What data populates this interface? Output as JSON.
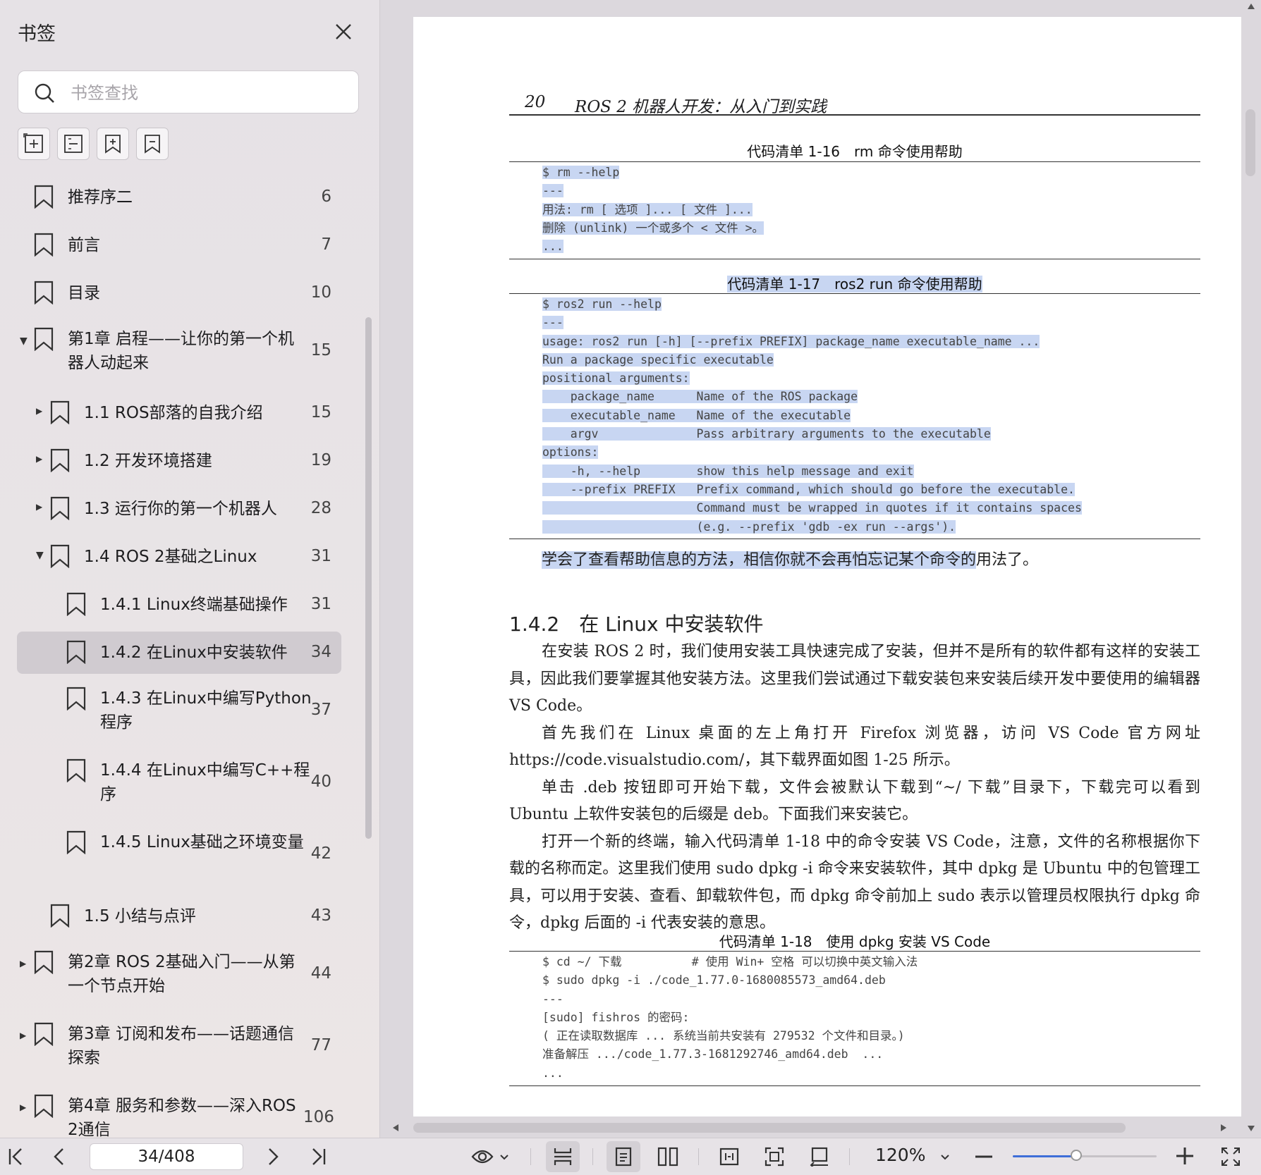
{
  "sidebar": {
    "title": "书签",
    "search_placeholder": "书签查找",
    "bookmarks": [
      {
        "label": "推荐序二",
        "page": "6",
        "level": 0,
        "expand": "none",
        "lines": 1
      },
      {
        "label": "前言",
        "page": "7",
        "level": 0,
        "expand": "none",
        "lines": 1
      },
      {
        "label": "目录",
        "page": "10",
        "level": 0,
        "expand": "none",
        "lines": 1
      },
      {
        "label": "第1章 启程——让你的第一个机器人动起来",
        "page": "15",
        "level": 0,
        "expand": "open",
        "lines": 2
      },
      {
        "label": "1.1 ROS部落的自我介绍",
        "page": "15",
        "level": 1,
        "expand": "closed",
        "lines": 1
      },
      {
        "label": "1.2 开发环境搭建",
        "page": "19",
        "level": 1,
        "expand": "closed",
        "lines": 1
      },
      {
        "label": "1.3 运行你的第一个机器人",
        "page": "28",
        "level": 1,
        "expand": "closed",
        "lines": 1
      },
      {
        "label": "1.4 ROS 2基础之Linux",
        "page": "31",
        "level": 1,
        "expand": "open",
        "lines": 1
      },
      {
        "label": "1.4.1 Linux终端基础操作",
        "page": "31",
        "level": 2,
        "expand": "none",
        "lines": 1
      },
      {
        "label": "1.4.2 在Linux中安装软件",
        "page": "34",
        "level": 2,
        "expand": "none",
        "lines": 1,
        "selected": true
      },
      {
        "label": "1.4.3 在Linux中编写Python程序",
        "page": "37",
        "level": 2,
        "expand": "none",
        "lines": 2
      },
      {
        "label": "1.4.4 在Linux中编写C++程序",
        "page": "40",
        "level": 2,
        "expand": "none",
        "lines": 2
      },
      {
        "label": "1.4.5 Linux基础之环境变量",
        "page": "42",
        "level": 2,
        "expand": "none",
        "lines": 2
      },
      {
        "label": "1.5 小结与点评",
        "page": "43",
        "level": 1,
        "expand": "none",
        "lines": 1
      },
      {
        "label": "第2章 ROS 2基础入门——从第一个节点开始",
        "page": "44",
        "level": 0,
        "expand": "closed",
        "lines": 2
      },
      {
        "label": "第3章 订阅和发布——话题通信探索",
        "page": "77",
        "level": 0,
        "expand": "closed",
        "lines": 2
      },
      {
        "label": "第4章 服务和参数——深入ROS 2通信",
        "page": "106",
        "level": 0,
        "expand": "closed",
        "lines": 2
      }
    ]
  },
  "document": {
    "page_number": "20",
    "running_title": "ROS 2 机器人开发：从入门到实践",
    "listing_16": {
      "caption": "代码清单 1-16　rm 命令使用帮助",
      "lines": [
        "$ rm --help",
        "---",
        "用法: rm [ 选项 ]... [ 文件 ]...",
        "删除 (unlink) 一个或多个 < 文件 >。",
        "..."
      ]
    },
    "listing_17": {
      "caption": "代码清单 1-17　ros2 run 命令使用帮助",
      "lines": [
        "$ ros2 run --help",
        "---",
        "usage: ros2 run [-h] [--prefix PREFIX] package_name executable_name ...",
        "Run a package specific executable",
        "positional arguments:",
        "    package_name      Name of the ROS package",
        "    executable_name   Name of the executable",
        "    argv              Pass arbitrary arguments to the executable",
        "options:",
        "    -h, --help        show this help message and exit",
        "    --prefix PREFIX   Prefix command, which should go before the executable.",
        "                      Command must be wrapped in quotes if it contains spaces",
        "                      (e.g. --prefix 'gdb -ex run --args')."
      ]
    },
    "after_listing_highlight": "学会了查看帮助信息的方法，相信你就不会再怕忘记某个命令的",
    "after_listing_rest": "用法了。",
    "section_heading": "1.4.2　在 Linux 中安装软件",
    "paragraphs": [
      "在安装 ROS 2 时，我们使用安装工具快速完成了安装，但并不是所有的软件都有这样的安装工具，因此我们要掌握其他安装方法。这里我们尝试通过下载安装包来安装后续开发中要使用的编辑器 VS Code。",
      "首先我们在 Linux 桌面的左上角打开 Firefox 浏览器，访问 VS Code 官方网址 https://code.visualstudio.com/，其下载界面如图 1-25 所示。",
      "单击 .deb 按钮即可开始下载，文件会被默认下载到“~/ 下载”目录下，下载完可以看到 Ubuntu 上软件安装包的后缀是 deb。下面我们来安装它。",
      "打开一个新的终端，输入代码清单 1-18 中的命令安装 VS Code，注意，文件的名称根据你下载的名称而定。这里我们使用 sudo dpkg -i 命令来安装软件，其中 dpkg 是 Ubuntu 中的包管理工具，可以用于安装、查看、卸载软件包，而 dpkg 命令前加上 sudo 表示以管理员权限执行 dpkg 命令，dpkg 后面的 -i 代表安装的意思。"
    ],
    "listing_18": {
      "caption": "代码清单 1-18　使用 dpkg 安装 VS Code",
      "lines": [
        "$ cd ~/ 下载          # 使用 Win+ 空格 可以切换中英文输入法",
        "$ sudo dpkg -i ./code_1.77.0-1680085573_amd64.deb",
        "---",
        "[sudo] fishros 的密码:",
        "( 正在读取数据库 ... 系统当前共安装有 279532 个文件和目录。)",
        "准备解压 .../code_1.77.3-1681292746_amd64.deb  ...",
        "..."
      ]
    }
  },
  "statusbar": {
    "page_indicator": "34/408",
    "zoom": "120%",
    "zoom_slider_fraction": 0.44
  },
  "colors": {
    "selection": "#c8d6f2",
    "accent": "#3e6ed8"
  }
}
